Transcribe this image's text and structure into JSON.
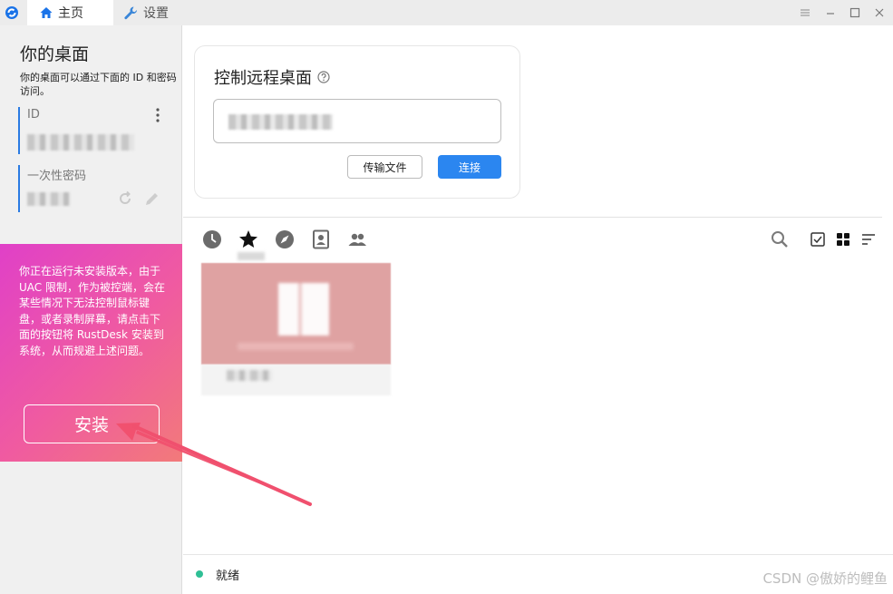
{
  "titlebar": {
    "tabs": [
      {
        "label": "主页",
        "icon": "home-icon",
        "active": true
      },
      {
        "label": "设置",
        "icon": "wrench-icon",
        "active": false
      }
    ],
    "window_controls": [
      "menu-icon",
      "minimize-icon",
      "maximize-icon",
      "close-icon"
    ]
  },
  "sidebar": {
    "title": "你的桌面",
    "description": "你的桌面可以通过下面的 ID 和密码访问。",
    "id_label": "ID",
    "password_label": "一次性密码",
    "install_notice": "你正在运行未安装版本，由于 UAC 限制，作为被控端，会在某些情况下无法控制鼠标键盘，或者录制屏幕，请点击下面的按钮将 RustDesk 安装到系统，从而规避上述问题。",
    "install_button": "安装"
  },
  "main": {
    "connect_card_title": "控制远程桌面",
    "transfer_button": "传输文件",
    "connect_button": "连接",
    "peer_tabs": [
      "recent-icon",
      "favorite-icon",
      "discover-icon",
      "address-book-icon",
      "group-icon"
    ],
    "view_controls": [
      "search-icon",
      "checkbox-icon",
      "grid-view-icon",
      "sort-icon"
    ]
  },
  "status": {
    "text": "就绪",
    "color": "#2fbf95"
  },
  "watermark": "CSDN @傲娇的鲤鱼",
  "colors": {
    "accent": "#2b86f0",
    "install_gradient_start": "#e040c8",
    "install_gradient_end": "#f27a7a",
    "annotation_arrow": "#f0506e"
  }
}
